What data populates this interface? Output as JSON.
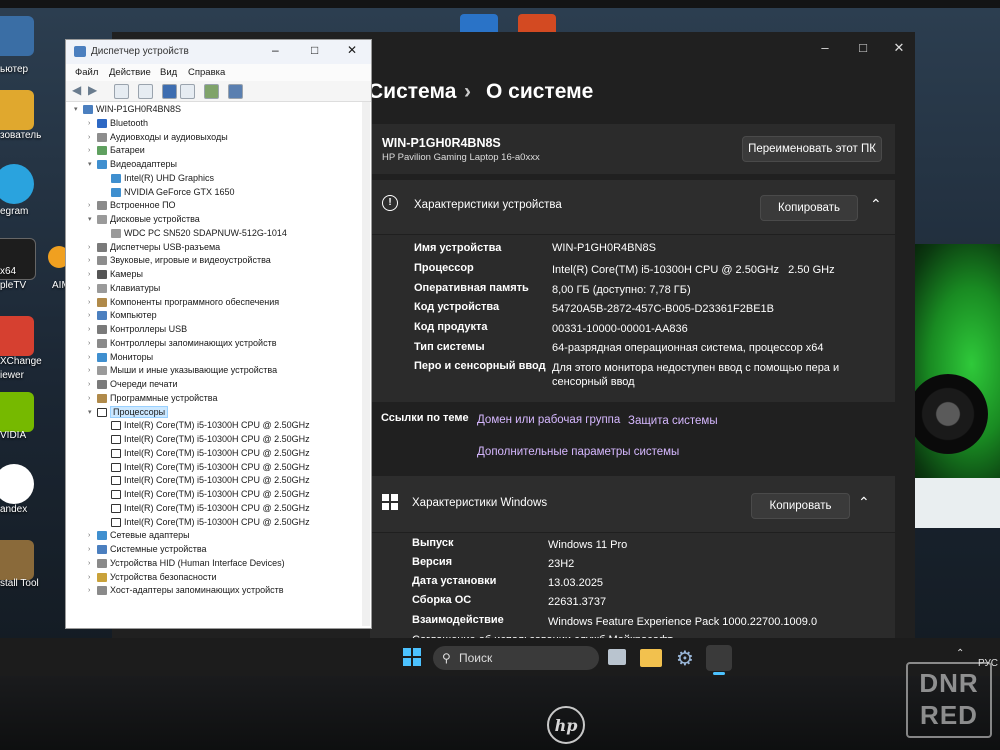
{
  "desktop": {
    "icons": [
      {
        "label": "ьютер"
      },
      {
        "label": "зователь"
      },
      {
        "label": "egram"
      },
      {
        "label": "x64"
      },
      {
        "label": "pleTV"
      },
      {
        "label": "AIM"
      },
      {
        "label": "XChange"
      },
      {
        "label": "iewer"
      },
      {
        "label": "VIDIA"
      },
      {
        "label": "andex"
      },
      {
        "label": "stall Tool"
      }
    ],
    "colors": {
      "accent_green": "#2fc93a"
    }
  },
  "settings": {
    "breadcrumb_parent": "Система",
    "breadcrumb_sep": "›",
    "breadcrumb_current": "О системе",
    "device_name": "WIN-P1GH0R4BN8S",
    "device_model": "HP Pavilion Gaming Laptop 16-a0xxx",
    "rename_button": "Переименовать этот ПК",
    "device_specs": {
      "title": "Характеристики устройства",
      "copy_button": "Копировать",
      "rows": [
        {
          "label": "Имя устройства",
          "value": "WIN-P1GH0R4BN8S"
        },
        {
          "label": "Процессор",
          "value": "Intel(R) Core(TM) i5-10300H CPU @ 2.50GHz   2.50 GHz"
        },
        {
          "label": "Оперативная память",
          "value": "8,00 ГБ (доступно: 7,78 ГБ)"
        },
        {
          "label": "Код устройства",
          "value": "54720A5B-2872-457C-B005-D23361F2BE1B"
        },
        {
          "label": "Код продукта",
          "value": "00331-10000-00001-AA836"
        },
        {
          "label": "Тип системы",
          "value": "64-разрядная операционная система, процессор x64"
        },
        {
          "label": "Перо и сенсорный ввод",
          "value": "Для этого монитора недоступен ввод с помощью пера и",
          "value2": "сенсорный ввод"
        }
      ]
    },
    "related": {
      "label": "Ссылки по теме",
      "links": [
        "Домен или рабочая группа",
        "Защита системы",
        "Дополнительные параметры системы"
      ]
    },
    "windows_specs": {
      "title": "Характеристики Windows",
      "copy_button": "Копировать",
      "rows": [
        {
          "label": "Выпуск",
          "value": "Windows 11 Pro"
        },
        {
          "label": "Версия",
          "value": "23H2"
        },
        {
          "label": "Дата установки",
          "value": "13.03.2025"
        },
        {
          "label": "Сборка ОС",
          "value": "22631.3737"
        },
        {
          "label": "Взаимодействие",
          "value": "Windows Feature Experience Pack 1000.22700.1009.0"
        }
      ],
      "partial_row": "Соглашение об использовании служб Майкрософт"
    }
  },
  "device_manager": {
    "title": "Диспетчер устройств",
    "menu": [
      "Файл",
      "Действие",
      "Вид",
      "Справка"
    ],
    "tree": [
      {
        "text": "WIN-P1GH0R4BN8S",
        "level": 0,
        "toggle": "v",
        "icon": "computer"
      },
      {
        "text": "Bluetooth",
        "level": 1,
        "toggle": ">",
        "icon": "bluetooth"
      },
      {
        "text": "Аудиовходы и аудиовыходы",
        "level": 1,
        "toggle": ">",
        "icon": "audio"
      },
      {
        "text": "Батареи",
        "level": 1,
        "toggle": ">",
        "icon": "battery"
      },
      {
        "text": "Видеоадаптеры",
        "level": 1,
        "toggle": "v",
        "icon": "display"
      },
      {
        "text": "Intel(R) UHD Graphics",
        "level": 2,
        "toggle": "",
        "icon": "display"
      },
      {
        "text": "NVIDIA GeForce GTX 1650",
        "level": 2,
        "toggle": "",
        "icon": "display"
      },
      {
        "text": "Встроенное ПО",
        "level": 1,
        "toggle": ">",
        "icon": "firmware"
      },
      {
        "text": "Дисковые устройства",
        "level": 1,
        "toggle": "v",
        "icon": "disk"
      },
      {
        "text": "WDC PC SN520 SDAPNUW-512G-1014",
        "level": 2,
        "toggle": "",
        "icon": "disk"
      },
      {
        "text": "Диспетчеры USB-разъема",
        "level": 1,
        "toggle": ">",
        "icon": "usb"
      },
      {
        "text": "Звуковые, игровые и видеоустройства",
        "level": 1,
        "toggle": ">",
        "icon": "audio"
      },
      {
        "text": "Камеры",
        "level": 1,
        "toggle": ">",
        "icon": "camera"
      },
      {
        "text": "Клавиатуры",
        "level": 1,
        "toggle": ">",
        "icon": "keyboard"
      },
      {
        "text": "Компоненты программного обеспечения",
        "level": 1,
        "toggle": ">",
        "icon": "software"
      },
      {
        "text": "Компьютер",
        "level": 1,
        "toggle": ">",
        "icon": "computer"
      },
      {
        "text": "Контроллеры USB",
        "level": 1,
        "toggle": ">",
        "icon": "usb"
      },
      {
        "text": "Контроллеры запоминающих устройств",
        "level": 1,
        "toggle": ">",
        "icon": "storage"
      },
      {
        "text": "Мониторы",
        "level": 1,
        "toggle": ">",
        "icon": "display"
      },
      {
        "text": "Мыши и иные указывающие устройства",
        "level": 1,
        "toggle": ">",
        "icon": "mouse"
      },
      {
        "text": "Очереди печати",
        "level": 1,
        "toggle": ">",
        "icon": "printer"
      },
      {
        "text": "Программные устройства",
        "level": 1,
        "toggle": ">",
        "icon": "software"
      },
      {
        "text": "Процессоры",
        "level": 1,
        "toggle": "v",
        "icon": "cpu",
        "selected": true
      },
      {
        "text": "Intel(R) Core(TM) i5-10300H CPU @ 2.50GHz",
        "level": 2,
        "toggle": "",
        "icon": "cpu"
      },
      {
        "text": "Intel(R) Core(TM) i5-10300H CPU @ 2.50GHz",
        "level": 2,
        "toggle": "",
        "icon": "cpu"
      },
      {
        "text": "Intel(R) Core(TM) i5-10300H CPU @ 2.50GHz",
        "level": 2,
        "toggle": "",
        "icon": "cpu"
      },
      {
        "text": "Intel(R) Core(TM) i5-10300H CPU @ 2.50GHz",
        "level": 2,
        "toggle": "",
        "icon": "cpu"
      },
      {
        "text": "Intel(R) Core(TM) i5-10300H CPU @ 2.50GHz",
        "level": 2,
        "toggle": "",
        "icon": "cpu"
      },
      {
        "text": "Intel(R) Core(TM) i5-10300H CPU @ 2.50GHz",
        "level": 2,
        "toggle": "",
        "icon": "cpu"
      },
      {
        "text": "Intel(R) Core(TM) i5-10300H CPU @ 2.50GHz",
        "level": 2,
        "toggle": "",
        "icon": "cpu"
      },
      {
        "text": "Intel(R) Core(TM) i5-10300H CPU @ 2.50GHz",
        "level": 2,
        "toggle": "",
        "icon": "cpu"
      },
      {
        "text": "Сетевые адаптеры",
        "level": 1,
        "toggle": ">",
        "icon": "network"
      },
      {
        "text": "Системные устройства",
        "level": 1,
        "toggle": ">",
        "icon": "system"
      },
      {
        "text": "Устройства HID (Human Interface Devices)",
        "level": 1,
        "toggle": ">",
        "icon": "hid"
      },
      {
        "text": "Устройства безопасности",
        "level": 1,
        "toggle": ">",
        "icon": "security"
      },
      {
        "text": "Хост-адаптеры запоминающих устройств",
        "level": 1,
        "toggle": ">",
        "icon": "storage"
      }
    ]
  },
  "taskbar": {
    "search_placeholder": "Поиск",
    "language": "РУС"
  },
  "branding": {
    "laptop_logo": "hp",
    "watermark_line1": "DNR",
    "watermark_line2": "RED"
  }
}
